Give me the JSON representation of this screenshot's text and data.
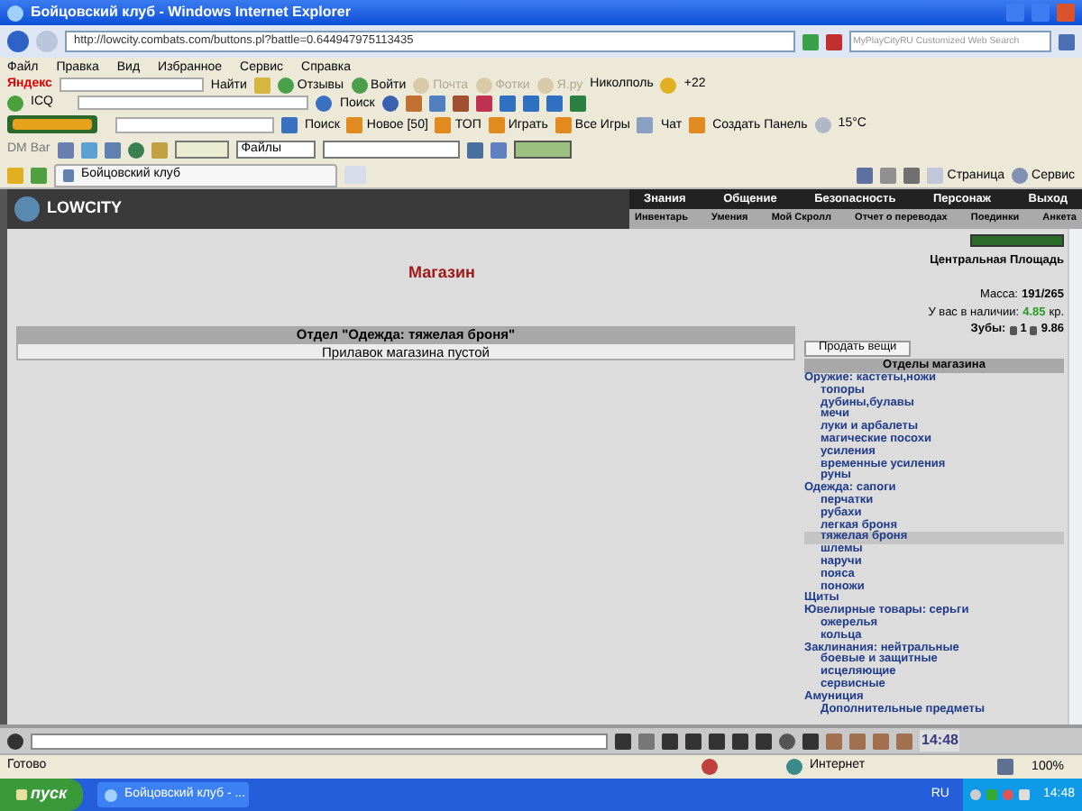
{
  "window": {
    "title": "Бойцовский клуб - Windows Internet Explorer"
  },
  "address": {
    "url": "http://lowcity.combats.com/buttons.pl?battle=0.644947975113435"
  },
  "search": {
    "placeholder": "MyPlayCityRU Customized Web Search"
  },
  "menu": [
    "Файл",
    "Правка",
    "Вид",
    "Избранное",
    "Сервис",
    "Справка"
  ],
  "yandex_bar": {
    "logo": "Яндекс",
    "find": "Найти",
    "items": [
      {
        "label": "Отзывы",
        "disabled": false
      },
      {
        "label": "Войти",
        "disabled": false
      },
      {
        "label": "Почта",
        "disabled": true
      },
      {
        "label": "Фотки",
        "disabled": true
      },
      {
        "label": "Я.ру",
        "disabled": true
      }
    ],
    "city": "Николполь",
    "bonus": "+22"
  },
  "icq_bar": {
    "label": "ICQ",
    "search": "Поиск"
  },
  "games_bar": {
    "search": "Поиск",
    "items": [
      "Новое [50]",
      "ТОП",
      "Играть",
      "Все Игры"
    ],
    "chat": "Чат",
    "create": "Создать Панель",
    "weather": "15°C"
  },
  "dm_bar": {
    "label": "DM Bar",
    "files": "Файлы"
  },
  "tab": {
    "title": "Бойцовский клуб"
  },
  "command_bar": [
    "Страница",
    "Сервис"
  ],
  "game": {
    "logo": "LOWCITY",
    "nav_top": [
      "Знания",
      "Общение",
      "Безопасность",
      "Персонаж",
      "Выход"
    ],
    "nav_bottom": [
      "Инвентарь",
      "Умения",
      "Мой Скролл",
      "Отчет о переводах",
      "Поединки",
      "Анкета"
    ],
    "shop_title": "Магазин",
    "department": "Отдел \"Одежда: тяжелая броня\"",
    "empty": "Прилавок магазина пустой",
    "location": "Центральная Площадь",
    "mass_label": "Масса:",
    "mass": "191/265",
    "money_label": "У вас в наличии:",
    "money": "4.85",
    "money_unit": "кр.",
    "teeth_label": "Зубы:",
    "teeth": "1",
    "teeth_2": "9.86",
    "sell_button": "Продать вещи",
    "departments_title": "Отделы магазина",
    "departments": [
      {
        "label": "Оружие: кастеты,ножи",
        "selected": false,
        "children": [
          {
            "label": "топоры",
            "selected": false
          },
          {
            "label": "дубины,булавы",
            "selected": false
          },
          {
            "label": "мечи",
            "selected": false
          },
          {
            "label": "луки и арбалеты",
            "selected": false
          },
          {
            "label": "магические посохи",
            "selected": false
          },
          {
            "label": "усиления",
            "selected": false
          },
          {
            "label": "временные усиления",
            "selected": false
          },
          {
            "label": "руны",
            "selected": false
          }
        ]
      },
      {
        "label": "Одежда: сапоги",
        "selected": false,
        "children": [
          {
            "label": "перчатки",
            "selected": false
          },
          {
            "label": "рубахи",
            "selected": false
          },
          {
            "label": "легкая броня",
            "selected": false
          },
          {
            "label": "тяжелая броня",
            "selected": true
          },
          {
            "label": "шлемы",
            "selected": false
          },
          {
            "label": "наручи",
            "selected": false
          },
          {
            "label": "пояса",
            "selected": false
          },
          {
            "label": "поножи",
            "selected": false
          }
        ]
      },
      {
        "label": "Щиты",
        "selected": false
      },
      {
        "label": "Ювелирные товары: серьги",
        "selected": false,
        "children": [
          {
            "label": "ожерелья",
            "selected": false
          },
          {
            "label": "кольца",
            "selected": false
          }
        ]
      },
      {
        "label": "Заклинания: нейтральные",
        "selected": false,
        "children": [
          {
            "label": "боевые и защитные",
            "selected": false
          },
          {
            "label": "исцеляющие",
            "selected": false
          },
          {
            "label": "сервисные",
            "selected": false
          }
        ]
      },
      {
        "label": "Амуниция",
        "selected": false,
        "children": [
          {
            "label": "Дополнительные предметы",
            "selected": false
          }
        ]
      }
    ]
  },
  "chat_bar": {
    "clock": "14:48"
  },
  "status_bar": {
    "text": "Готово",
    "zone": "Интернет",
    "zoom": "100%"
  },
  "taskbar": {
    "start": "пуск",
    "window": "Бойцовский клуб - ...",
    "lang": "RU",
    "time": "14:48"
  }
}
